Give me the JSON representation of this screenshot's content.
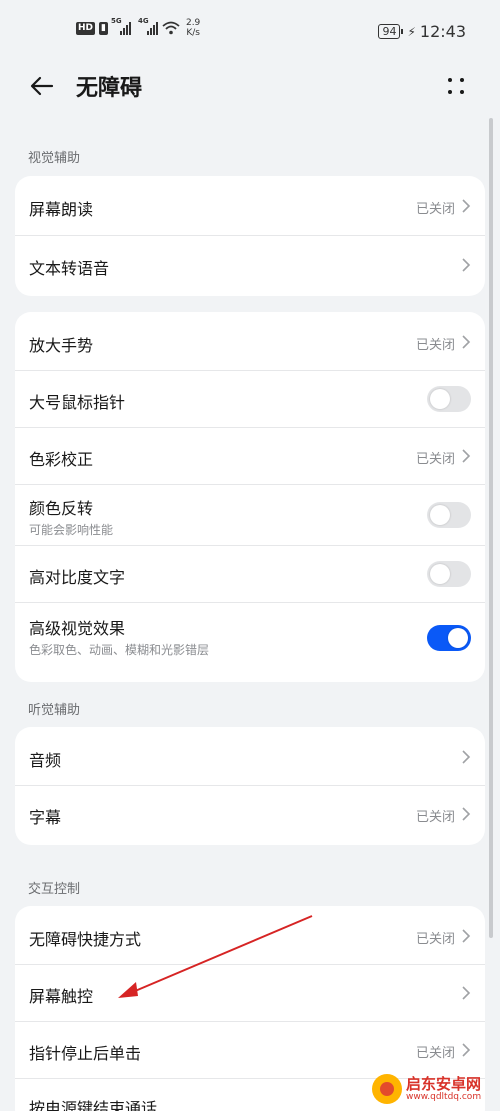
{
  "status_bar": {
    "hd": "HD",
    "sim1_type": "5G",
    "sim2_type": "4G",
    "speed_value": "2.9",
    "speed_unit": "K/s",
    "battery": "94",
    "time": "12:43"
  },
  "header": {
    "title": "无障碍",
    "back_icon": "back-arrow-icon",
    "more_icon": "more-dots-icon"
  },
  "sections": [
    {
      "header": "视觉辅助"
    },
    {
      "header": "听觉辅助"
    },
    {
      "header": "交互控制"
    }
  ],
  "card_vision_1": {
    "rows": [
      {
        "title": "屏幕朗读",
        "value": "已关闭"
      },
      {
        "title": "文本转语音",
        "value": ""
      }
    ]
  },
  "card_vision_2": {
    "rows": [
      {
        "title": "放大手势",
        "value": "已关闭"
      },
      {
        "title": "大号鼠标指针",
        "toggle": false
      },
      {
        "title": "色彩校正",
        "value": "已关闭"
      },
      {
        "title": "颜色反转",
        "subtitle": "可能会影响性能",
        "toggle": false
      },
      {
        "title": "高对比度文字",
        "toggle": false
      },
      {
        "title": "高级视觉效果",
        "subtitle": "色彩取色、动画、模糊和光影错层",
        "toggle": true
      }
    ]
  },
  "card_hearing": {
    "rows": [
      {
        "title": "音频",
        "value": ""
      },
      {
        "title": "字幕",
        "value": "已关闭"
      }
    ]
  },
  "card_interaction": {
    "rows": [
      {
        "title": "无障碍快捷方式",
        "value": "已关闭"
      },
      {
        "title": "屏幕触控",
        "value": ""
      },
      {
        "title": "指针停止后单击",
        "value": "已关闭"
      },
      {
        "title": "按电源键结束通话",
        "value": ""
      }
    ]
  },
  "watermark": {
    "name": "启东安卓网",
    "url": "www.qdltdq.com"
  },
  "colors": {
    "accent": "#0a59f7",
    "annotation_arrow": "#d62424",
    "background": "#f1f3f5"
  }
}
